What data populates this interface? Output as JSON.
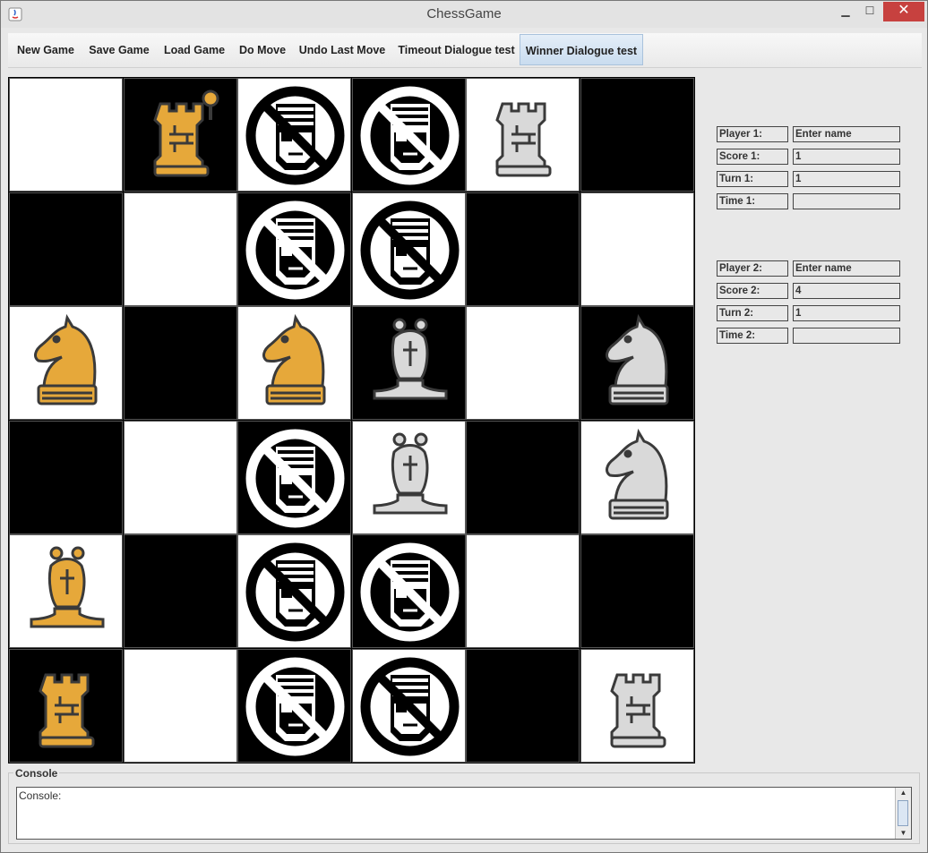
{
  "window": {
    "title": "ChessGame",
    "minimize_glyph": "▁",
    "maximize_glyph": "☐",
    "close_glyph": "✕"
  },
  "toolbar": {
    "items": [
      {
        "label": "New Game"
      },
      {
        "label": "Save Game"
      },
      {
        "label": "Load Game"
      },
      {
        "label": "Do Move"
      },
      {
        "label": "Undo Last Move"
      },
      {
        "label": "Timeout Dialogue test"
      },
      {
        "label": "Winner Dialogue test",
        "active": true
      }
    ]
  },
  "board": {
    "rows": [
      [
        "empty",
        "gold-rook-key",
        "pirate",
        "pirate",
        "silver-rook",
        "empty"
      ],
      [
        "empty",
        "empty",
        "pirate",
        "pirate",
        "empty",
        "empty"
      ],
      [
        "gold-knight",
        "empty",
        "gold-knight",
        "silver-bishop",
        "empty",
        "silver-knight"
      ],
      [
        "empty",
        "empty",
        "pirate",
        "silver-bishop",
        "empty",
        "silver-knight"
      ],
      [
        "gold-bishop",
        "empty",
        "pirate",
        "pirate",
        "empty",
        "empty"
      ],
      [
        "gold-rook",
        "empty",
        "pirate",
        "pirate",
        "empty",
        "silver-rook"
      ]
    ],
    "colors": {
      "gold": "#e6a83a",
      "silver": "#d9d9d9",
      "dark": "#000000",
      "light": "#ffffff"
    }
  },
  "player1": {
    "name_label": "Player 1:",
    "name_value": "Enter name",
    "score_label": "Score 1:",
    "score_value": "1",
    "turn_label": "Turn 1:",
    "turn_value": "1",
    "time_label": "Time 1:",
    "time_value": ""
  },
  "player2": {
    "name_label": "Player 2:",
    "name_value": "Enter name",
    "score_label": "Score 2:",
    "score_value": "4",
    "turn_label": "Turn 2:",
    "turn_value": "1",
    "time_label": "Time 2:",
    "time_value": ""
  },
  "console": {
    "legend": "Console",
    "text": "Console:"
  }
}
